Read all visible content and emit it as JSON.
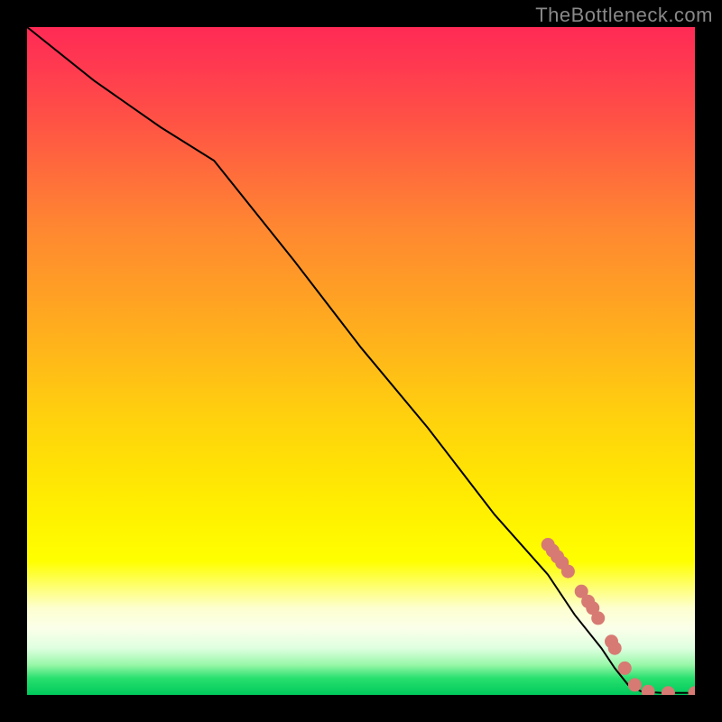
{
  "watermark": "TheBottleneck.com",
  "colors": {
    "marker": "#d77a73",
    "curve": "#000000"
  },
  "chart_data": {
    "type": "line",
    "title": "",
    "xlabel": "",
    "ylabel": "",
    "xlim": [
      0,
      100
    ],
    "ylim": [
      0,
      100
    ],
    "grid": false,
    "legend": false,
    "series": [
      {
        "name": "curve",
        "x": [
          0,
          10,
          20,
          28,
          40,
          50,
          60,
          70,
          78,
          82,
          86,
          88,
          90,
          92,
          95,
          100
        ],
        "y": [
          100,
          92,
          85,
          80,
          65,
          52,
          40,
          27,
          18,
          12,
          7,
          4,
          1.5,
          0.5,
          0.3,
          0.3
        ]
      }
    ],
    "markers": [
      {
        "x": 78.0,
        "y": 22.5
      },
      {
        "x": 78.7,
        "y": 21.6
      },
      {
        "x": 79.4,
        "y": 20.7
      },
      {
        "x": 80.1,
        "y": 19.8
      },
      {
        "x": 81.0,
        "y": 18.5
      },
      {
        "x": 83.0,
        "y": 15.5
      },
      {
        "x": 84.0,
        "y": 14.0
      },
      {
        "x": 84.7,
        "y": 13.0
      },
      {
        "x": 85.5,
        "y": 11.5
      },
      {
        "x": 87.5,
        "y": 8.0
      },
      {
        "x": 88.0,
        "y": 7.0
      },
      {
        "x": 89.5,
        "y": 4.0
      },
      {
        "x": 91.0,
        "y": 1.5
      },
      {
        "x": 93.0,
        "y": 0.5
      },
      {
        "x": 96.0,
        "y": 0.3
      },
      {
        "x": 100.0,
        "y": 0.3
      }
    ]
  }
}
